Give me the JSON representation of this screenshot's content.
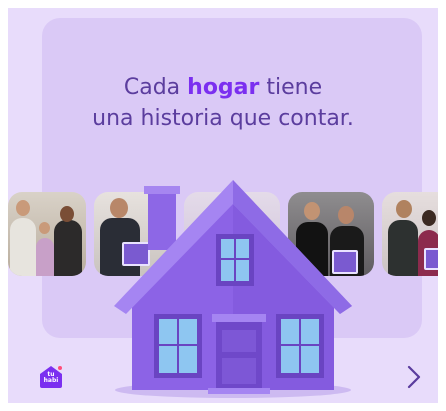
{
  "headline": {
    "line1_pre": "Cada ",
    "line1_highlight": "hogar",
    "line1_post": " tiene",
    "line2": "una historia que contar."
  },
  "logo": {
    "text_line1": "tu",
    "text_line2": "habi"
  },
  "photos": [
    {
      "alt_icon": "family-photo-icon"
    },
    {
      "alt_icon": "man-with-sign-photo-icon"
    },
    {
      "alt_icon": "couple-photo-icon"
    },
    {
      "alt_icon": "couple-with-sign-photo-icon"
    },
    {
      "alt_icon": "couple-with-sign-photo-icon"
    }
  ],
  "icons": {
    "next": "chevron-right-icon",
    "house": "house-illustration-icon"
  },
  "colors": {
    "accent": "#7b2ff0",
    "text": "#5b3d9e",
    "background": "#e8dcfb",
    "panel": "#dac9f6",
    "house": "#8c63e6"
  }
}
